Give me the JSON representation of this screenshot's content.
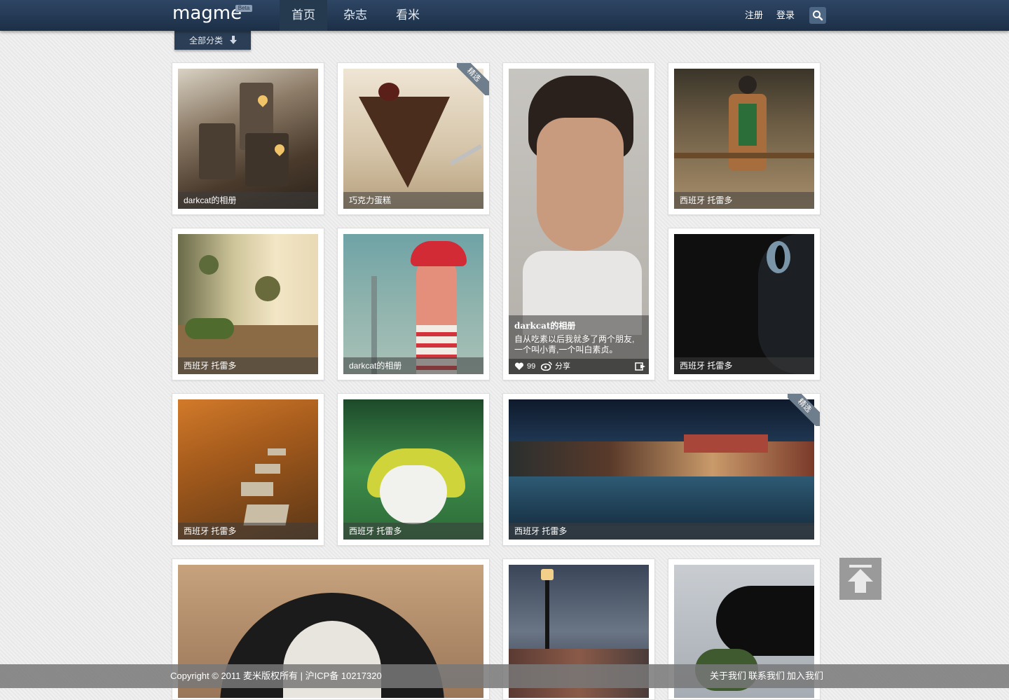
{
  "header": {
    "logo": "magme",
    "beta": "Beta",
    "nav": [
      "首页",
      "杂志",
      "看米"
    ],
    "register": "注册",
    "login": "登录"
  },
  "category_button": "全部分类",
  "tiles": [
    {
      "caption": "darkcat的相册"
    },
    {
      "caption": "巧克力蛋糕",
      "ribbon": "精选"
    },
    {
      "caption": "西班牙 托雷多"
    },
    {
      "caption": "西班牙 托雷多"
    },
    {
      "caption": "darkcat的相册"
    },
    {
      "caption": "西班牙 托雷多"
    },
    {
      "caption": "西班牙 托雷多"
    },
    {
      "caption": "西班牙 托雷多"
    },
    {
      "caption": "西班牙 托雷多",
      "ribbon": "精选"
    }
  ],
  "featured": {
    "author": "darkcat的相册",
    "line1": "自从吃素以后我就多了两个朋友,",
    "line2": "一个叫小青,一个叫白素贞。",
    "likes": "99",
    "share": "分享"
  },
  "footer": {
    "copyright": "Copyright © 2011 麦米版权所有 | 沪ICP备 10217320",
    "about": "关于我们",
    "contact": "联系我们",
    "join": "加入我们"
  },
  "icons": [
    "search-icon",
    "arrow-down-icon",
    "heart-icon",
    "weibo-icon",
    "share-out-icon",
    "back-to-top-icon"
  ]
}
